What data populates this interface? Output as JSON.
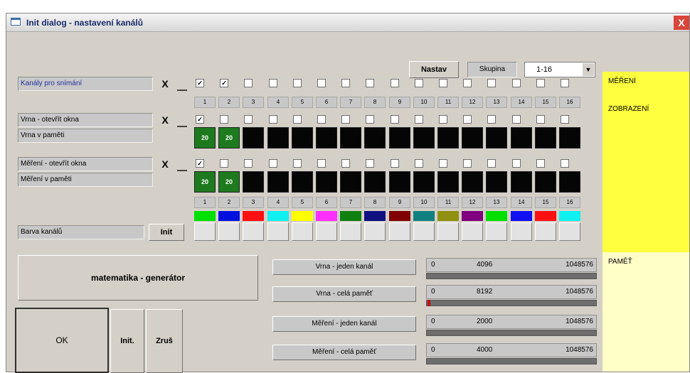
{
  "window": {
    "title": "Init dialog - nastavení kanálů",
    "close_label": "X"
  },
  "top": {
    "nastav_label": "Nastav",
    "skupina_label": "Skupina",
    "combo_value": "1-16",
    "combo_arrow": "▼"
  },
  "rows": {
    "kanaly_label": "Kanály pro snímání",
    "vrna_open_label": "Vrna - otevřít okna",
    "vrna_memory_label": "Vrna v paměti",
    "mereni_open_label": "Měření - otevřít okna",
    "mereni_memory_label": "Měření v paměti",
    "barva_label": "Barva kanálů",
    "init_label": "Init",
    "x_label": "X",
    "block_text": "20"
  },
  "channel_numbers": [
    "1",
    "2",
    "3",
    "4",
    "5",
    "6",
    "7",
    "8",
    "9",
    "10",
    "11",
    "12",
    "13",
    "14",
    "15",
    "16"
  ],
  "checks": {
    "kanaly": [
      true,
      true,
      false,
      false,
      false,
      false,
      false,
      false,
      false,
      false,
      false,
      false,
      false,
      false,
      false,
      false
    ],
    "vrna_open": [
      true,
      false,
      false,
      false,
      false,
      false,
      false,
      false,
      false,
      false,
      false,
      false,
      false,
      false,
      false,
      false
    ],
    "mereni_open": [
      true,
      false,
      false,
      false,
      false,
      false,
      false,
      false,
      false,
      false,
      false,
      false,
      false,
      false,
      false,
      false
    ]
  },
  "channel_colors": [
    "#00e000",
    "#0010e0",
    "#ff1010",
    "#10f0f0",
    "#ffff00",
    "#ff30ff",
    "#108010",
    "#101080",
    "#800000",
    "#108080",
    "#909010",
    "#800080",
    "#00e000",
    "#1010f0",
    "#ff1010",
    "#10f0f0"
  ],
  "buttons": {
    "matematika": "matematika - generátor",
    "ok": "OK",
    "init": "Init.",
    "zrus": "Zruš"
  },
  "memory": [
    {
      "label": "Vrna - jeden kanál",
      "min": "0",
      "value": "4096",
      "max": "1048576"
    },
    {
      "label": "Vrna - celá paměť",
      "min": "0",
      "value": "8192",
      "max": "1048576"
    },
    {
      "label": "Měření - jeden kanál",
      "min": "0",
      "value": "2000",
      "max": "1048576"
    },
    {
      "label": "Měření - celá paměť",
      "min": "0",
      "value": "4000",
      "max": "1048576"
    }
  ],
  "side": {
    "mereni": "MĚŘENÍ",
    "zobrazeni": "ZOBRAZENÍ",
    "pamet": "PAMĚŤ"
  },
  "colors": {
    "side_yellow": "#ffff40",
    "side_pale": "#ffffc8",
    "block_green": "#1e7a1e"
  }
}
